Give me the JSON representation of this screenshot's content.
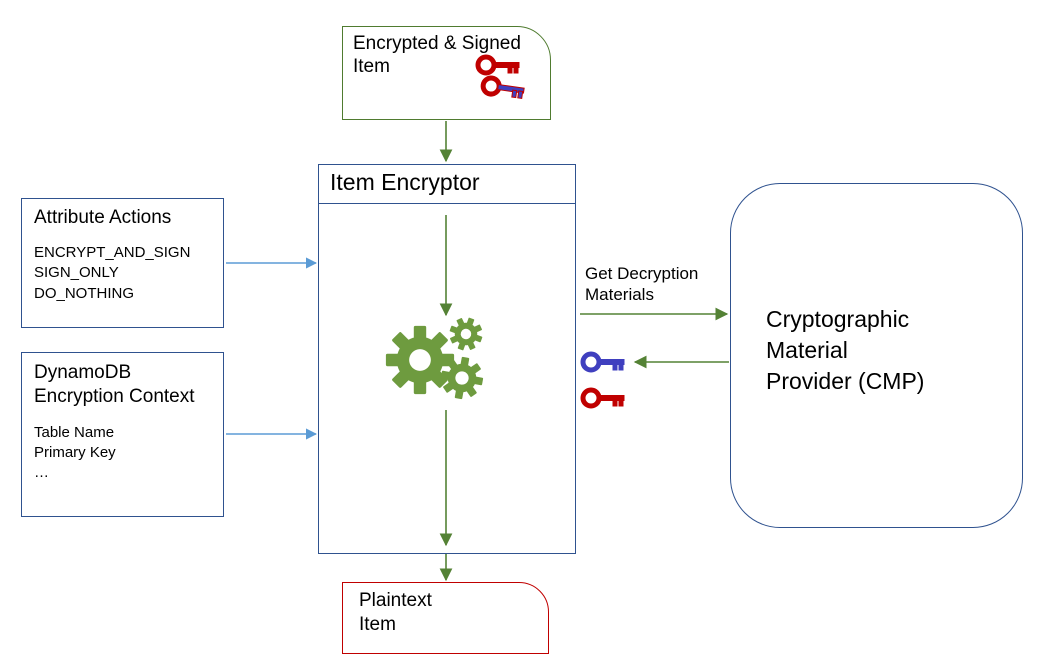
{
  "top": {
    "title": "Encrypted & Signed Item"
  },
  "encryptor": {
    "title": "Item Encryptor"
  },
  "attrbox": {
    "title": "Attribute Actions",
    "l1": "ENCRYPT_AND_SIGN",
    "l2": "SIGN_ONLY",
    "l3": "DO_NOTHING"
  },
  "ctxbox": {
    "title1": "DynamoDB",
    "title2": "Encryption Context",
    "l1": "Table Name",
    "l2": "Primary Key",
    "l3": "…"
  },
  "getmat": {
    "l1": "Get Decryption",
    "l2": "Materials"
  },
  "cmp": {
    "l1": "Cryptographic",
    "l2": "Material",
    "l3": "Provider (CMP)"
  },
  "out": {
    "l1": "Plaintext",
    "l2": "Item"
  }
}
